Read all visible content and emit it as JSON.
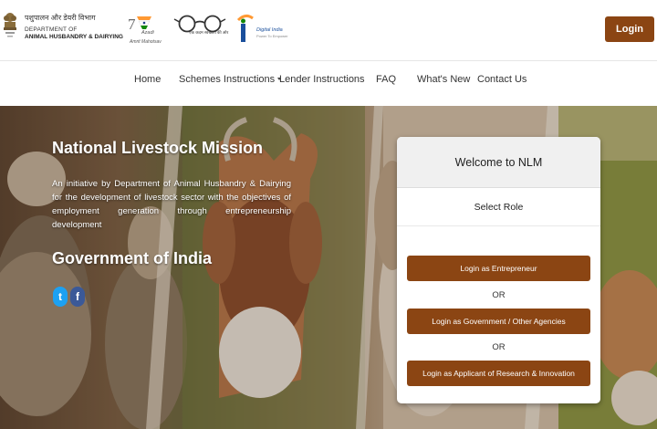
{
  "header": {
    "dept_hindi": "पशुपालन और डेयरी विभाग",
    "dept_line1": "DEPARTMENT OF",
    "dept_line2": "ANIMAL HUSBANDRY & DAIRYING",
    "azadi_text1": "Azadi",
    "azadi_text2": "Amrit Mahotsav",
    "swachh_text": "एक कदम स्वच्छता की ओर",
    "digital_title": "Digital India",
    "digital_sub": "Power To Empower",
    "login_label": "Login"
  },
  "nav": {
    "items": [
      {
        "label": "Home"
      },
      {
        "label": "Schemes Instructions"
      },
      {
        "label": "Lender Instructions"
      },
      {
        "label": "FAQ"
      },
      {
        "label": "What's New"
      },
      {
        "label": "Contact Us"
      }
    ]
  },
  "hero": {
    "title": "National Livestock Mission",
    "description": "An initiative by Department of Animal Husbandry & Dairying for the development of livestock sector with the objectives of employment generation through entrepreneurship development",
    "gov": "Government of India",
    "twitter_glyph": "t",
    "facebook_glyph": "f"
  },
  "card": {
    "title": "Welcome to NLM",
    "role_label": "Select Role",
    "buttons": [
      {
        "label": "Login as Entrepreneur"
      },
      {
        "label": "Login as Government / Other Agencies"
      },
      {
        "label": "Login as Applicant of Research & Innovation"
      }
    ],
    "or_label": "OR"
  },
  "colors": {
    "brand_brown": "#8b4513",
    "twitter": "#1da1f2",
    "facebook": "#3b5998"
  },
  "icons": {
    "emblem": "emblem-of-india-icon",
    "azadi": "azadi-ka-amrit-mahotsav-logo",
    "swachh": "swachh-bharat-glasses-logo",
    "digital": "digital-india-logo",
    "caret": "caret-down-icon",
    "twitter": "twitter-icon",
    "facebook": "facebook-icon"
  }
}
